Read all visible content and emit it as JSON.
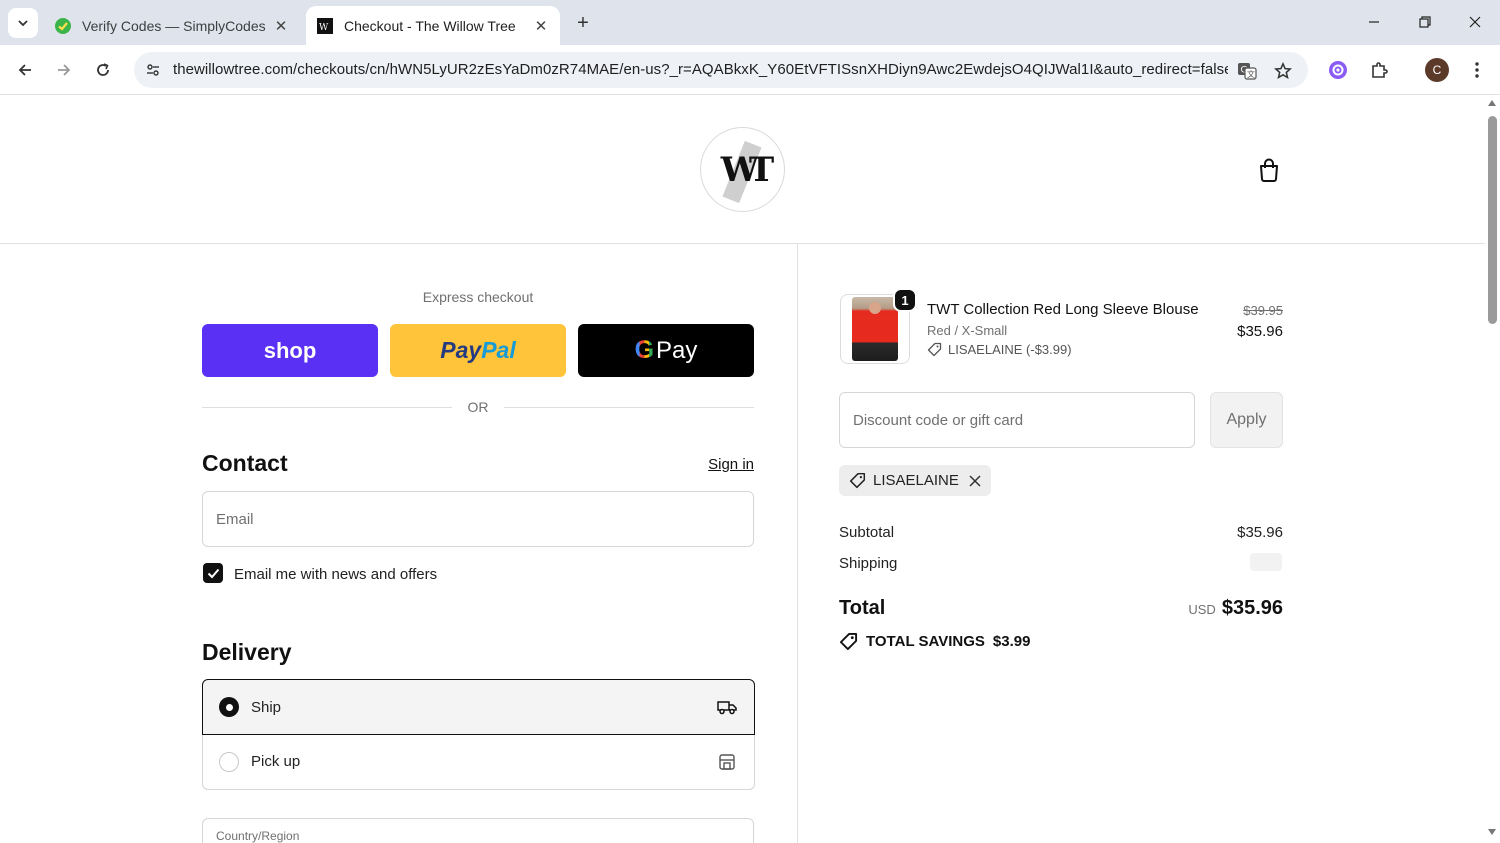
{
  "browser": {
    "tabs": [
      {
        "title": "Verify Codes — SimplyCodes",
        "active": false,
        "favicon": "simplycodes-icon"
      },
      {
        "title": "Checkout - The Willow Tree",
        "active": true,
        "favicon": "willowtree-icon"
      }
    ],
    "url": "thewillowtree.com/checkouts/cn/hWN5LyUR2zEsYaDm0zR74MAE/en-us?_r=AQABkxK_Y60EtVFTISsnXHDiyn9Awc2EwdejsO4QIJWal1I&auto_redirect=false...",
    "profile_initial": "C"
  },
  "header": {
    "logo_text": "WT"
  },
  "express": {
    "label": "Express checkout",
    "shop_label": "shop",
    "paypal_part1": "Pay",
    "paypal_part2": "Pal",
    "gpay_g": "G",
    "gpay_label": "Pay",
    "or_label": "OR"
  },
  "contact": {
    "title": "Contact",
    "sign_in": "Sign in",
    "email_placeholder": "Email",
    "newsletter_label": "Email me with news and offers",
    "newsletter_checked": true
  },
  "delivery": {
    "title": "Delivery",
    "options": [
      {
        "label": "Ship",
        "selected": true,
        "icon": "truck-icon"
      },
      {
        "label": "Pick up",
        "selected": false,
        "icon": "store-icon"
      }
    ],
    "country_label": "Country/Region"
  },
  "order": {
    "item": {
      "quantity": "1",
      "name": "TWT Collection Red Long Sleeve Blouse",
      "variant": "Red / X-Small",
      "discount": "LISAELAINE (-$3.99)",
      "original_price": "$39.95",
      "price": "$35.96"
    },
    "discount_placeholder": "Discount code or gift card",
    "apply_label": "Apply",
    "applied_code": "LISAELAINE",
    "subtotal_label": "Subtotal",
    "subtotal_value": "$35.96",
    "shipping_label": "Shipping",
    "total_label": "Total",
    "currency": "USD",
    "total_value": "$35.96",
    "savings_label": "TOTAL SAVINGS",
    "savings_value": "$3.99"
  }
}
